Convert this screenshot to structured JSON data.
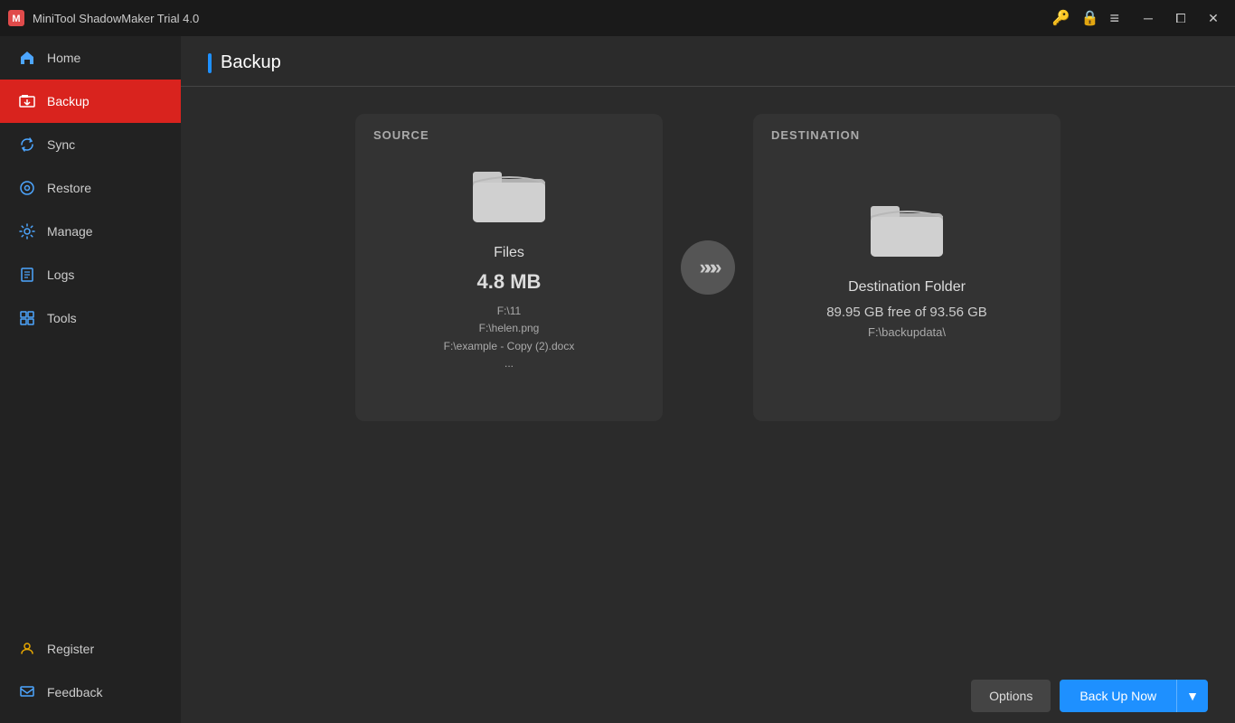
{
  "app": {
    "title": "MiniTool ShadowMaker Trial 4.0",
    "logo_text": "M"
  },
  "titlebar": {
    "key_icon": "🔑",
    "lock_icon": "🔒",
    "menu_icon": "≡",
    "minimize": "─",
    "restore": "⧠",
    "close": "✕"
  },
  "sidebar": {
    "items": [
      {
        "id": "home",
        "label": "Home",
        "active": false
      },
      {
        "id": "backup",
        "label": "Backup",
        "active": true
      },
      {
        "id": "sync",
        "label": "Sync",
        "active": false
      },
      {
        "id": "restore",
        "label": "Restore",
        "active": false
      },
      {
        "id": "manage",
        "label": "Manage",
        "active": false
      },
      {
        "id": "logs",
        "label": "Logs",
        "active": false
      },
      {
        "id": "tools",
        "label": "Tools",
        "active": false
      }
    ],
    "register": "Register",
    "feedback": "Feedback"
  },
  "page": {
    "title": "Backup"
  },
  "source_card": {
    "label": "SOURCE",
    "name": "Files",
    "size": "4.8 MB",
    "paths": [
      "F:\\11",
      "F:\\helen.png",
      "F:\\example - Copy (2).docx",
      "..."
    ]
  },
  "destination_card": {
    "label": "DESTINATION",
    "name": "Destination Folder",
    "free_space": "89.95 GB free of 93.56 GB",
    "path": "F:\\backupdata\\"
  },
  "footer": {
    "options_label": "Options",
    "backup_now_label": "Back Up Now"
  }
}
